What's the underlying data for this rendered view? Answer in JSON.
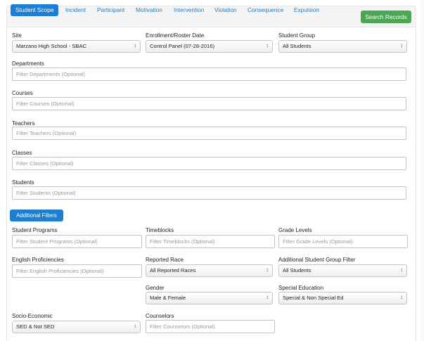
{
  "tabs": [
    {
      "label": "Student Scope",
      "active": true
    },
    {
      "label": "Incident"
    },
    {
      "label": "Participant"
    },
    {
      "label": "Motivation"
    },
    {
      "label": "Intervention"
    },
    {
      "label": "Violation"
    },
    {
      "label": "Consequence"
    },
    {
      "label": "Expulsion"
    }
  ],
  "search_button": "Search Records",
  "scope": {
    "site": {
      "label": "Site",
      "value": "Marzano High School - SBAC"
    },
    "enrollment": {
      "label": "Enrollment/Roster Date",
      "value": "Control Panel (07-28-2016)"
    },
    "student_group": {
      "label": "Student Group",
      "value": "All Students"
    },
    "departments": {
      "label": "Departments",
      "placeholder": "Filter Departments (Optional)"
    },
    "courses": {
      "label": "Courses",
      "placeholder": "Filter Courses (Optional)"
    },
    "teachers": {
      "label": "Teachers",
      "placeholder": "Filter Teachers (Optional)"
    },
    "classes": {
      "label": "Classes",
      "placeholder": "Filter Classes (Optional)"
    },
    "students": {
      "label": "Students",
      "placeholder": "Filter Students (Optional)"
    }
  },
  "additional_filters_button": "Additional Filters",
  "filters": {
    "student_programs": {
      "label": "Student Programs",
      "placeholder": "Filter Student Programs (Optional)"
    },
    "timeblocks": {
      "label": "Timeblocks",
      "placeholder": "Filter Timeblocks (Optional)"
    },
    "grade_levels": {
      "label": "Grade Levels",
      "placeholder": "Filter Grade Levels (Optional)"
    },
    "english_proficiencies": {
      "label": "English Proficiencies",
      "placeholder": "Filter English Proficiencies (Optional)"
    },
    "reported_race": {
      "label": "Reported Race",
      "value": "All Reported Races"
    },
    "additional_student_group": {
      "label": "Additional Student Group Filter",
      "value": "All Students"
    },
    "gender": {
      "label": "Gender",
      "value": "Male & Female"
    },
    "special_education": {
      "label": "Special Education",
      "value": "Special & Non Special Ed"
    },
    "socio_economic": {
      "label": "Socio-Economic",
      "value": "SED & Not SED"
    },
    "counselors": {
      "label": "Counselors",
      "placeholder": "Filter Counselors (Optional)"
    }
  },
  "icons": {
    "select_arrow": "updown-arrow-icon"
  },
  "colors": {
    "primary": "#1c7fd2",
    "success": "#4aa852",
    "link": "#2a7ab8"
  }
}
